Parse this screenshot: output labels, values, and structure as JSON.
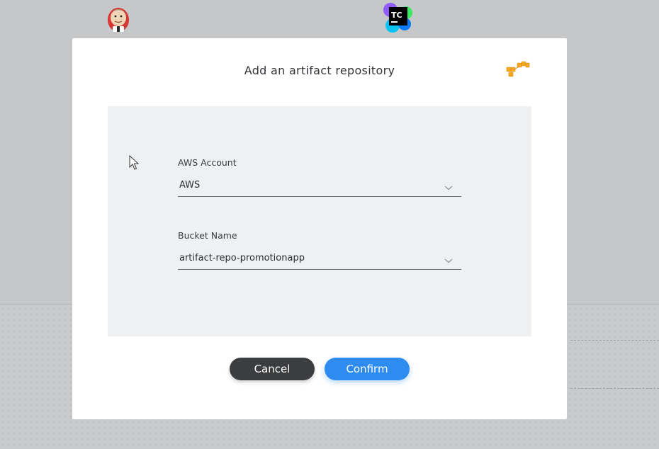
{
  "background": {
    "logos": [
      {
        "name": "jenkins-logo"
      },
      {
        "name": "teamcity-logo",
        "text": "TC"
      }
    ]
  },
  "dialog": {
    "title": "Add an artifact repository",
    "icon": "aws-s3-buckets-icon",
    "fields": [
      {
        "label": "AWS Account",
        "value": "AWS"
      },
      {
        "label": "Bucket Name",
        "value": "artifact-repo-promotionapp"
      }
    ],
    "buttons": {
      "cancel": "Cancel",
      "confirm": "Confirm"
    }
  },
  "colors": {
    "confirm": "#2e8cf0",
    "cancel": "#3c3d3f",
    "panel": "#eff0f1",
    "aws_orange": "#f5a623"
  }
}
